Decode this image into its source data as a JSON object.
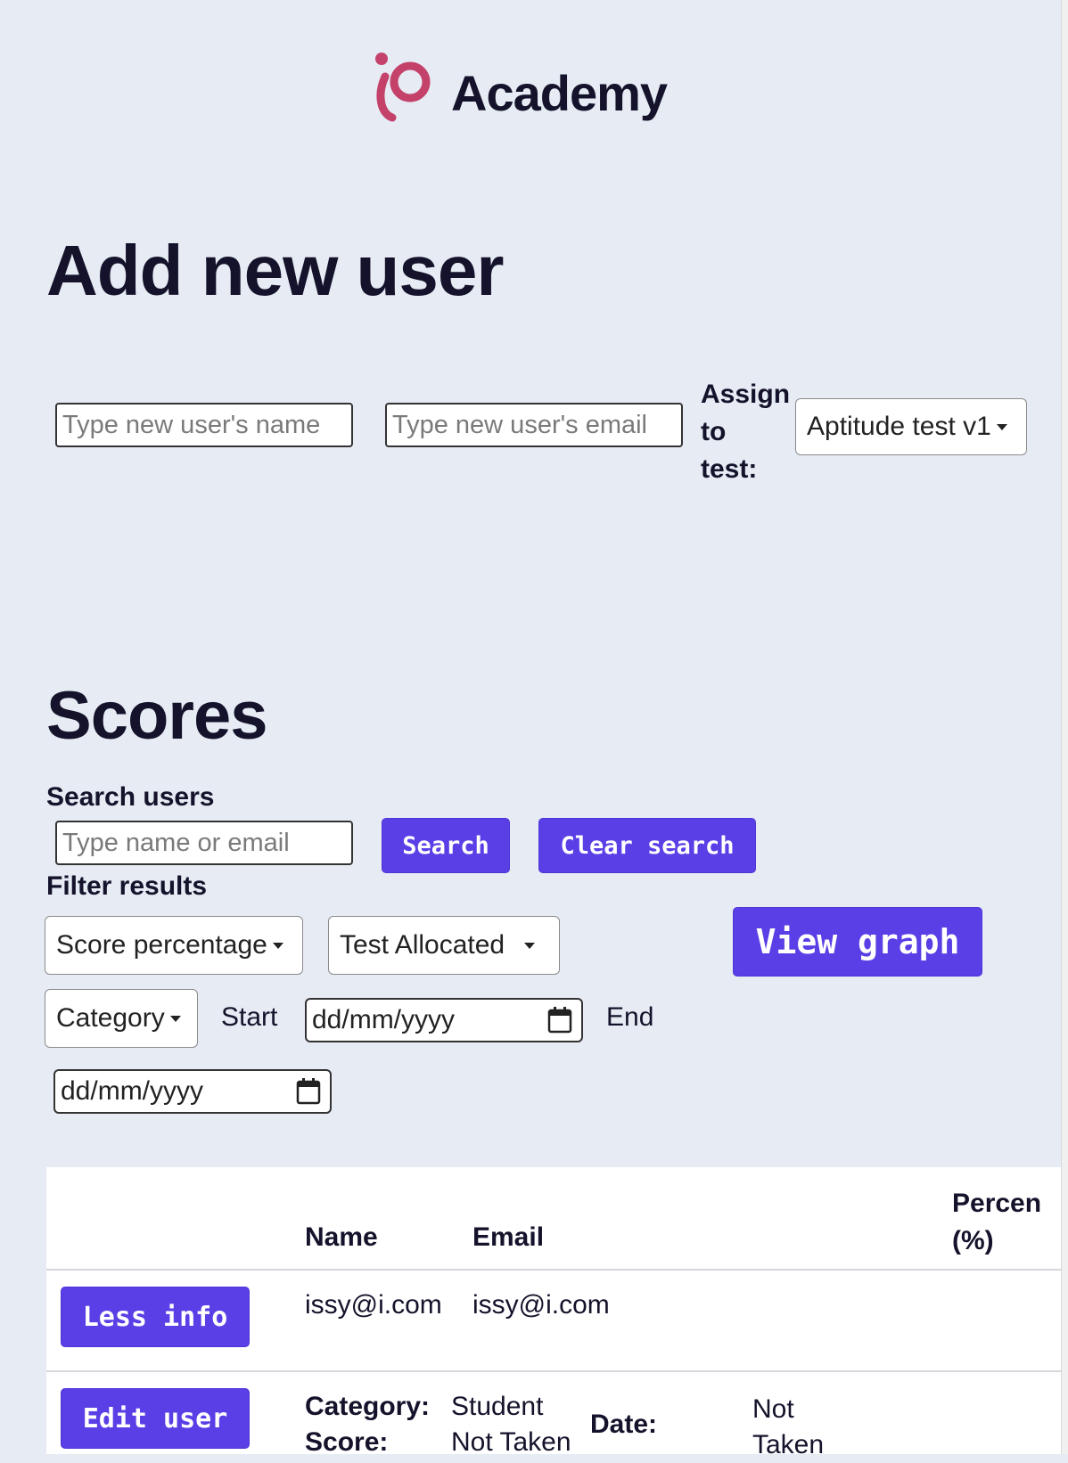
{
  "brand": {
    "name": "Academy"
  },
  "add_user": {
    "title": "Add new user",
    "name_placeholder": "Type new user's name",
    "email_placeholder": "Type new user's email",
    "assign_label": [
      "Assign",
      "to",
      "test:"
    ],
    "test_selected": "Aptitude test v1"
  },
  "scores": {
    "title": "Scores",
    "search_label": "Search users",
    "search_placeholder": "Type name or email",
    "search_button": "Search",
    "clear_button": "Clear search",
    "filter_label": "Filter results",
    "filter_score": "Score percentage",
    "filter_test": "Test Allocated",
    "view_graph": "View graph",
    "filter_category": "Category",
    "start_label": "Start",
    "end_label": "End",
    "date_placeholder": "dd/mm/yyyy"
  },
  "table": {
    "headers": {
      "name": "Name",
      "email": "Email",
      "percent_line1": "Percen",
      "percent_line2": "(%)"
    },
    "row": {
      "less_info_button": "Less info",
      "name": "issy@i.com",
      "email": "issy@i.com",
      "edit_button": "Edit user",
      "category_label": "Category:",
      "category_value": "Student",
      "score_label": "Score:",
      "score_value": "Not Taken",
      "date_label": "Date:",
      "date_value_line1": "Not",
      "date_value_line2": "Taken"
    }
  },
  "colors": {
    "accent": "#5a3fe6",
    "brand": "#c4416a",
    "background": "#e6ebf4"
  },
  "icons": {
    "calendar": "calendar-icon",
    "dropdown": "chevron-down-icon"
  }
}
